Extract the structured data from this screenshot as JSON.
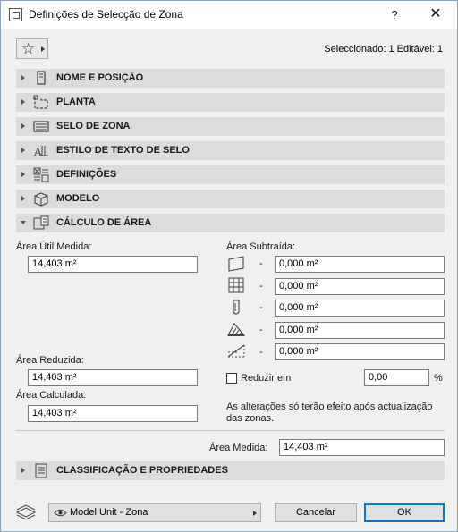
{
  "window": {
    "title": "Definições de Selecção de Zona",
    "help": "?",
    "close": "✕"
  },
  "header": {
    "selection_info": "Seleccionado: 1 Editável: 1"
  },
  "panels": [
    {
      "label": "NOME E POSIÇÃO",
      "icon": "name-position-icon",
      "expanded": false
    },
    {
      "label": "PLANTA",
      "icon": "floor-plan-icon",
      "expanded": false
    },
    {
      "label": "SELO DE ZONA",
      "icon": "zone-stamp-icon",
      "expanded": false
    },
    {
      "label": "ESTILO DE TEXTO DE SELO",
      "icon": "text-style-icon",
      "expanded": false
    },
    {
      "label": "DEFINIÇÕES",
      "icon": "settings-icon",
      "expanded": false
    },
    {
      "label": "MODELO",
      "icon": "model-icon",
      "expanded": false
    },
    {
      "label": "CÁLCULO DE ÁREA",
      "icon": "area-calculation-icon",
      "expanded": true
    }
  ],
  "area": {
    "measured_useful_label": "Área Útil Medida:",
    "measured_useful_value": "14,403 m²",
    "reduced_label": "Área Reduzida:",
    "reduced_value": "14,403 m²",
    "calculated_label": "Área Calculada:",
    "calculated_value": "14,403 m²",
    "subtracted_label": "Área Subtraída:",
    "subtracted_rows": [
      {
        "icon": "wall-icon",
        "dash": "-",
        "value": "0,000 m²"
      },
      {
        "icon": "column-grid-icon",
        "dash": "-",
        "value": "0,000 m²"
      },
      {
        "icon": "column-icon",
        "dash": "-",
        "value": "0,000 m²"
      },
      {
        "icon": "fill-hatch-icon",
        "dash": "-",
        "value": "0,000 m²"
      },
      {
        "icon": "low-height-icon",
        "dash": "-",
        "value": "0,000 m²"
      }
    ],
    "reduce_label": "Reduzir em",
    "reduce_value": "0,00",
    "percent": "%",
    "note": "As alterações só terão efeito após actualização das zonas.",
    "measured_label": "Área Medida:",
    "measured_value": "14,403 m²"
  },
  "footer_panel": {
    "label": "CLASSIFICAÇÃO E PROPRIEDADES",
    "icon": "classification-icon",
    "expanded": false
  },
  "footer": {
    "layer": "Model Unit - Zona",
    "cancel": "Cancelar",
    "ok": "OK"
  }
}
